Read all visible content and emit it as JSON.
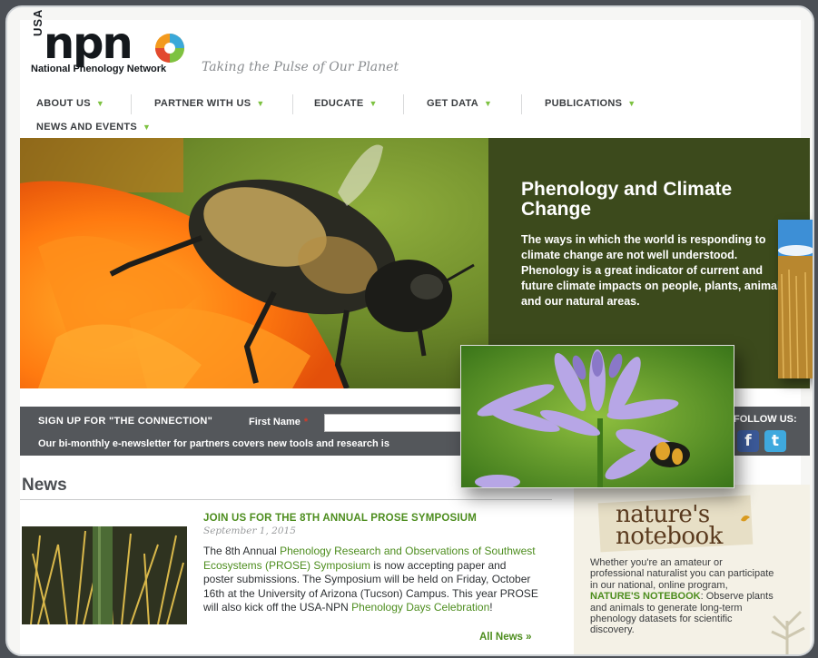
{
  "brand": {
    "usa": "USA",
    "npn": "npn",
    "subtitle": "National Phenology Network",
    "tagline": "Taking the Pulse of Our Planet"
  },
  "nav": {
    "items": [
      {
        "label": "ABOUT US"
      },
      {
        "label": "PARTNER WITH US"
      },
      {
        "label": "EDUCATE"
      },
      {
        "label": "GET DATA"
      },
      {
        "label": "PUBLICATIONS"
      },
      {
        "label": "NEWS AND EVENTS"
      }
    ],
    "caret": "▼"
  },
  "hero": {
    "title": "Phenology and Climate Change",
    "text": "The ways in which the world is responding to climate change are not well understood. Phenology is a great indicator of current and future climate impacts on people, plants, animals and our natural areas."
  },
  "signup": {
    "title": "SIGN UP FOR \"THE CONNECTION\"",
    "first_name_label": "First Name",
    "required_mark": "*",
    "first_name_value": "",
    "description": "Our bi-monthly e-newsletter for partners covers new tools and research is",
    "follow_label": "FOLLOW US:"
  },
  "news": {
    "heading": "News",
    "item": {
      "title": "JOIN US FOR THE 8TH ANNUAL PROSE SYMPOSIUM",
      "date": "September 1, 2015",
      "body_1": "The 8th Annual ",
      "body_link": "Phenology Research and Observations of Southwest Ecosystems (PROSE) Symposium",
      "body_2": " is now accepting paper and poster submissions. The Symposium will be held on Friday, October 16th at the University of Arizona (Tucson) Campus. This year PROSE will also kick off the USA-NPN ",
      "body_link2": "Phenology Days Celebration",
      "body_3": "!"
    },
    "all_news": "All News »"
  },
  "natures_notebook": {
    "logo_line1": "nature's",
    "logo_line2": "notebook",
    "text_1": "Whether you're an amateur or professional naturalist you can participate in our national, online program, ",
    "text_bold": "NATURE'S NOTEBOOK",
    "text_2": ": Observe plants and animals to generate long-term phenology datasets for scientific discovery."
  },
  "colors": {
    "accent_green": "#7dc241",
    "link_green": "#4d8d1e",
    "hero_panel": "#3c4a1c",
    "signup_bar": "#54575b"
  },
  "icons": {
    "facebook": "facebook-icon",
    "twitter": "twitter-icon"
  }
}
